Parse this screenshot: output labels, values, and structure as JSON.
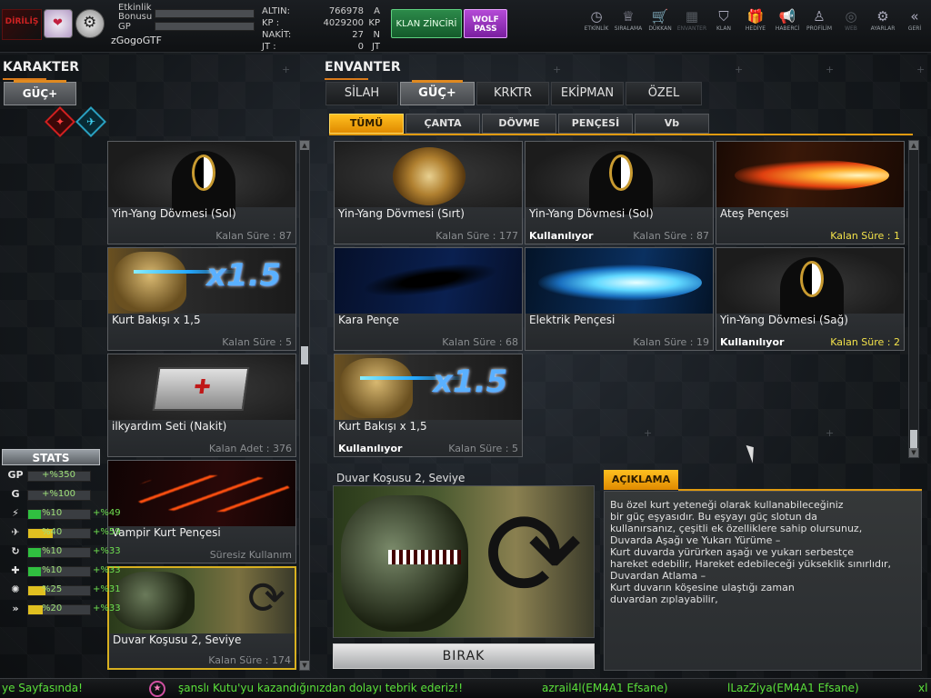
{
  "header": {
    "logo": "DİRİLİŞ",
    "label_event_bonus": "Etkinlik Bonusu",
    "label_gp": "GP",
    "username": "zGogoGTF",
    "currency": [
      {
        "key": "ALTIN:",
        "value": "766978",
        "unit": "A"
      },
      {
        "key": "KP :",
        "value": "4029200",
        "unit": "KP"
      },
      {
        "key": "NAKİT:",
        "value": "27",
        "unit": "N"
      },
      {
        "key": "JT :",
        "value": "0",
        "unit": "JT"
      }
    ],
    "clan_chain_button": "KLAN ZİNCİRİ",
    "wolf_pass_button_line1": "WOLF",
    "wolf_pass_button_line2": "PASS"
  },
  "topnav": [
    {
      "label": "ETKİNLİK",
      "icon": "clock-icon",
      "glyph": "◷"
    },
    {
      "label": "SIRALAMA",
      "icon": "rank-icon",
      "glyph": "♕"
    },
    {
      "label": "DÜKKAN",
      "icon": "cart-icon",
      "glyph": "🛒"
    },
    {
      "label": "ENVANTER",
      "icon": "inventory-icon",
      "glyph": "▦"
    },
    {
      "label": "KLAN",
      "icon": "shield-icon",
      "glyph": "⛉"
    },
    {
      "label": "HEDİYE",
      "icon": "gift-icon",
      "glyph": "🎁"
    },
    {
      "label": "HABERCİ",
      "icon": "megaphone-icon",
      "glyph": "📢"
    },
    {
      "label": "PROFİLİM",
      "icon": "profile-icon",
      "glyph": "♙"
    },
    {
      "label": "WEB",
      "icon": "globe-icon",
      "glyph": "◎"
    },
    {
      "label": "AYARLAR",
      "icon": "gear-icon",
      "glyph": "⚙"
    },
    {
      "label": "GERİ",
      "icon": "back-icon",
      "glyph": "«"
    }
  ],
  "character": {
    "title": "KARAKTER",
    "tab": "GÜÇ+",
    "items": [
      {
        "name": "Yin-Yang Dövmesi (Sol)",
        "remaining": "Kalan Süre : 87",
        "art": "art-dark",
        "in_use": ""
      },
      {
        "name": "Kurt Bakışı x 1,5",
        "remaining": "Kalan Süre : 5",
        "art": "art-wolf",
        "in_use": ""
      },
      {
        "name": "ilkyardım Seti (Nakit)",
        "remaining": "Kalan Adet : 376",
        "art": "art-kit",
        "in_use": ""
      },
      {
        "name": "Vampir Kurt Pençesi",
        "remaining": "Süresiz Kullanım",
        "art": "art-claw-red",
        "in_use": ""
      },
      {
        "name": "Duvar Koşusu 2, Seviye",
        "remaining": "Kalan Süre : 174",
        "art": "art-wall",
        "in_use": ""
      }
    ]
  },
  "stats": {
    "title": "STATS",
    "rows": [
      {
        "icon": "gp-icon",
        "glyph": "GP",
        "value": "+%350",
        "bonus": "",
        "fill": 0,
        "color": "g"
      },
      {
        "icon": "g-icon",
        "glyph": "G",
        "value": "+%100",
        "bonus": "",
        "fill": 0,
        "color": "g"
      },
      {
        "icon": "run-icon",
        "glyph": "⚡",
        "value": "%10",
        "bonus": "+%49",
        "fill": 0.2,
        "color": "g"
      },
      {
        "icon": "sprint-icon",
        "glyph": "✈",
        "value": "%40",
        "bonus": "+%59",
        "fill": 0.4,
        "color": "y"
      },
      {
        "icon": "recover-icon",
        "glyph": "↻",
        "value": "%10",
        "bonus": "+%33",
        "fill": 0.2,
        "color": "g"
      },
      {
        "icon": "health-icon",
        "glyph": "✚",
        "value": "%10",
        "bonus": "+%33",
        "fill": 0.2,
        "color": "g"
      },
      {
        "icon": "power-icon",
        "glyph": "✺",
        "value": "%25",
        "bonus": "+%31",
        "fill": 0.28,
        "color": "y"
      },
      {
        "icon": "speed-icon",
        "glyph": "»",
        "value": "%20",
        "bonus": "+%33",
        "fill": 0.24,
        "color": "y"
      }
    ]
  },
  "inventory": {
    "title": "ENVANTER",
    "tabs": [
      "SİLAH",
      "GÜÇ+",
      "KRKTR",
      "EKİPMAN",
      "ÖZEL"
    ],
    "subtabs": [
      "TÜMÜ",
      "ÇANTA",
      "DÖVME",
      "PENÇESİ",
      "Vb"
    ],
    "items": [
      {
        "name": "Yin-Yang Dövmesi (Sırt)",
        "remaining": "Kalan Süre : 177",
        "art": "art-dragon",
        "in_use": "",
        "highlight": false
      },
      {
        "name": "Yin-Yang Dövmesi (Sol)",
        "remaining": "Kalan Süre : 87",
        "art": "art-dark",
        "in_use": "Kullanılıyor",
        "highlight": false
      },
      {
        "name": "Ateş Pençesi",
        "remaining": "Kalan Süre : 1",
        "art": "art-claw-fire",
        "in_use": "",
        "highlight": true
      },
      {
        "name": "Kara Pençe",
        "remaining": "Kalan Süre : 68",
        "art": "art-claw-black",
        "in_use": "",
        "highlight": false
      },
      {
        "name": "Elektrik Pençesi",
        "remaining": "Kalan Süre : 19",
        "art": "art-claw-elec",
        "in_use": "",
        "highlight": false
      },
      {
        "name": "Yin-Yang Dövmesi (Sağ)",
        "remaining": "Kalan Süre : 2",
        "art": "art-dark",
        "in_use": "Kullanılıyor",
        "highlight": true
      },
      {
        "name": "Kurt Bakışı x 1,5",
        "remaining": "Kalan Süre : 5",
        "art": "art-wolf",
        "in_use": "Kullanılıyor",
        "highlight": false
      }
    ]
  },
  "detail": {
    "title": "Duvar Koşusu 2, Seviye",
    "drop_button": "BIRAK",
    "description_title": "AÇIKLAMA",
    "description_lines": [
      "Bu özel kurt yeteneği olarak kullanabileceğiniz",
      "bir güç eşyasıdır.  Bu eşyayı güç slotun da",
      "kullanırsanız, çeşitli ek özelliklere sahip olursunuz,",
      "Duvarda Aşağı ve Yukarı Yürüme –",
      "Kurt duvarda yürürken aşağı ve yukarı serbestçe",
      "hareket edebilir, Hareket edebileceği yükseklik sınırlıdır,",
      "Duvardan Atlama –",
      "Kurt duvarın köşesine ulaştığı zaman",
      "duvardan zıplayabilir,"
    ]
  },
  "ticker": {
    "segments": [
      "ye Sayfasında!",
      "şanslı Kutu'yu kazandığınızdan dolayı tebrik ederiz!!",
      "azrail4l(EM4A1 Efsane)",
      "lLazZiya(EM4A1 Efsane)",
      "xl"
    ]
  }
}
